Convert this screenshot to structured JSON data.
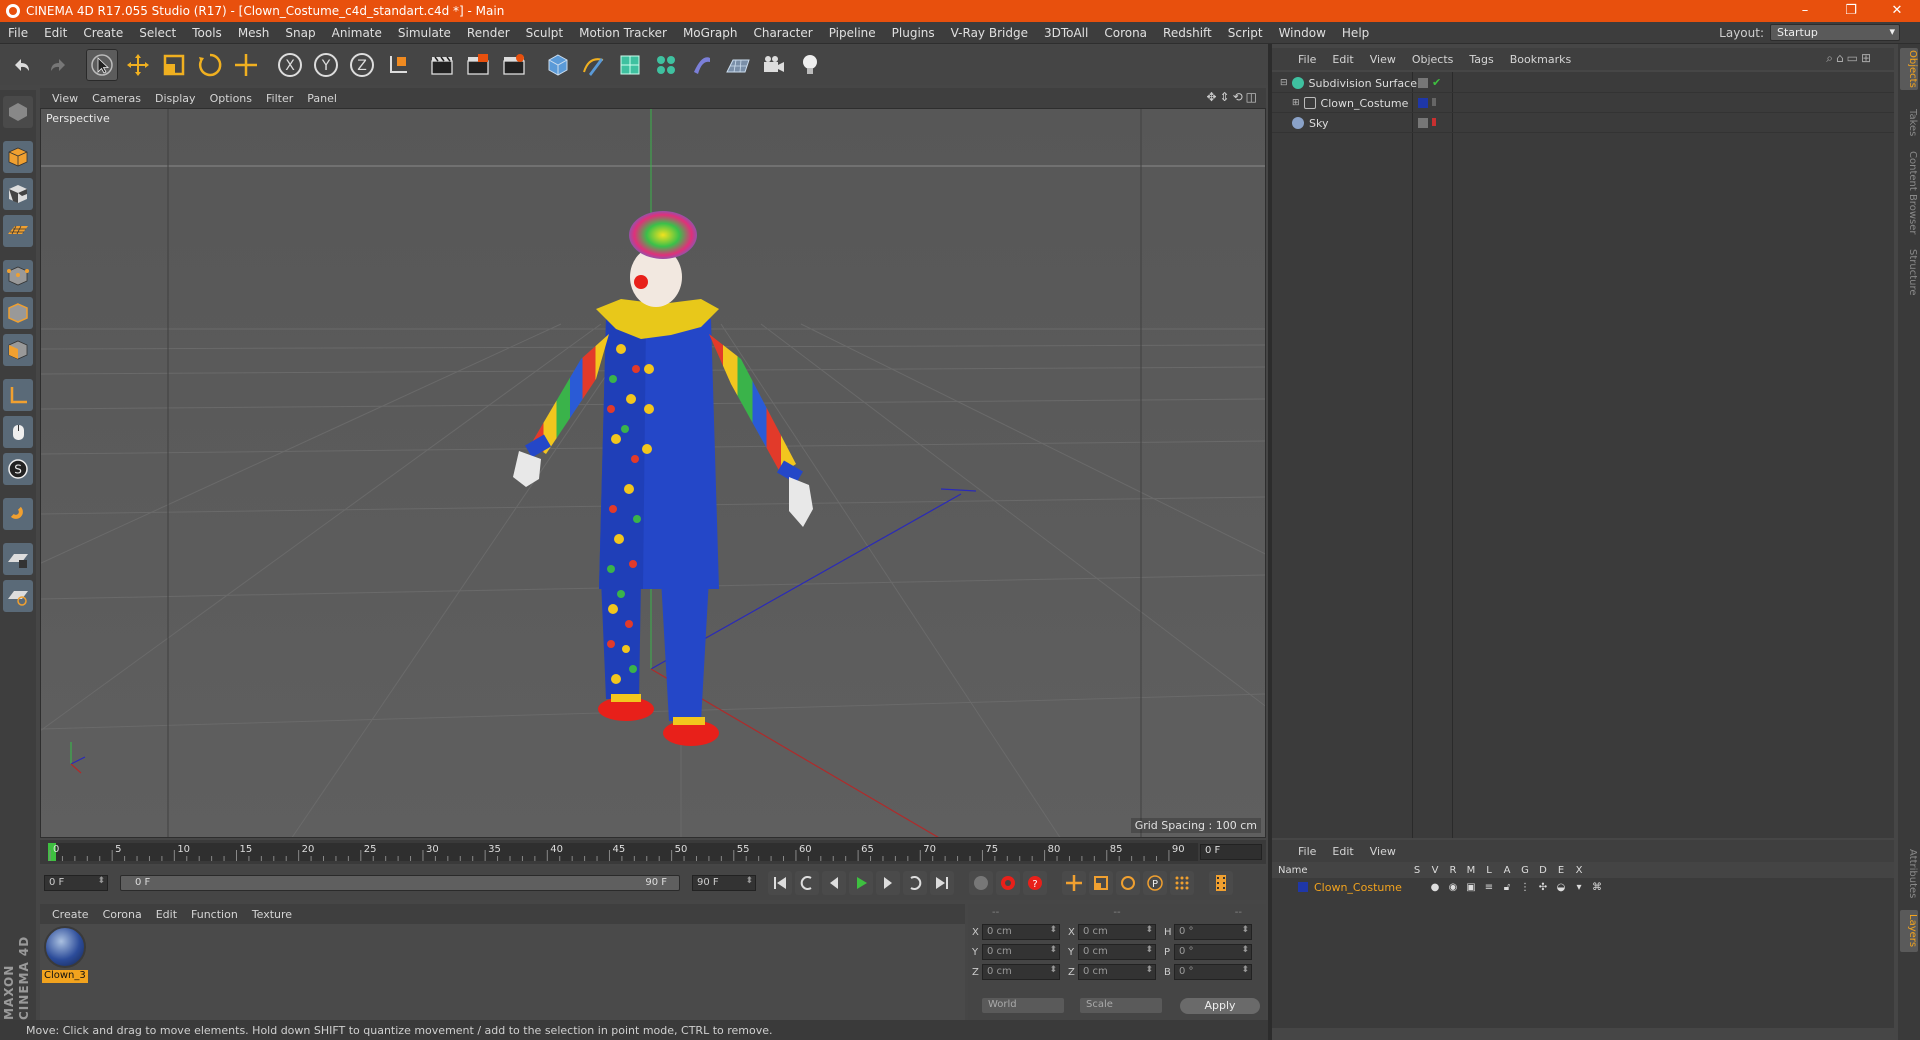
{
  "titlebar": {
    "title": "CINEMA 4D R17.055 Studio (R17) - [Clown_Costume_c4d_standart.c4d *] - Main",
    "minimize": "–",
    "restore": "❐",
    "close": "✕"
  },
  "menubar": {
    "items": [
      "File",
      "Edit",
      "Create",
      "Select",
      "Tools",
      "Mesh",
      "Snap",
      "Animate",
      "Simulate",
      "Render",
      "Sculpt",
      "Motion Tracker",
      "MoGraph",
      "Character",
      "Pipeline",
      "Plugins",
      "V-Ray Bridge",
      "3DToAll",
      "Corona",
      "Redshift",
      "Script",
      "Window",
      "Help"
    ],
    "layout_label": "Layout:",
    "layout_value": "Startup"
  },
  "viewport": {
    "menu": [
      "View",
      "Cameras",
      "Display",
      "Options",
      "Filter",
      "Panel"
    ],
    "label": "Perspective",
    "grid_spacing": "Grid Spacing : 100 cm"
  },
  "timeline": {
    "ticks": [
      "0",
      "5",
      "10",
      "15",
      "20",
      "25",
      "30",
      "35",
      "40",
      "45",
      "50",
      "55",
      "60",
      "65",
      "70",
      "75",
      "80",
      "85",
      "90"
    ],
    "current_frame": "0 F"
  },
  "transport": {
    "start_field": "0 F",
    "slider_left": "0 F",
    "slider_right": "90 F",
    "end_field": "90 F"
  },
  "materials": {
    "menu": [
      "Create",
      "Corona",
      "Edit",
      "Function",
      "Texture"
    ],
    "items": [
      {
        "name": "Clown_3"
      }
    ]
  },
  "coordinates": {
    "headers": [
      "--",
      "--",
      "--"
    ],
    "rows": [
      {
        "a": "X",
        "av": "0 cm",
        "b": "X",
        "bv": "0 cm",
        "c": "H",
        "cv": "0 °"
      },
      {
        "a": "Y",
        "av": "0 cm",
        "b": "Y",
        "bv": "0 cm",
        "c": "P",
        "cv": "0 °"
      },
      {
        "a": "Z",
        "av": "0 cm",
        "b": "Z",
        "bv": "0 cm",
        "c": "B",
        "cv": "0 °"
      }
    ],
    "space": "World",
    "mode": "Scale",
    "apply": "Apply"
  },
  "status": {
    "text": "Move: Click and drag to move elements. Hold down SHIFT to quantize movement / add to the selection in point mode, CTRL to remove."
  },
  "object_manager": {
    "menu": [
      "File",
      "Edit",
      "View",
      "Objects",
      "Tags",
      "Bookmarks"
    ],
    "objects": [
      {
        "name": "Subdivision Surface",
        "icon_color": "#3fc1a0"
      },
      {
        "name": "Clown_Costume",
        "icon_color": "#9a9a9a"
      },
      {
        "name": "Sky",
        "icon_color": "#8aa2c8"
      }
    ]
  },
  "layers_manager": {
    "menu": [
      "File",
      "Edit",
      "View"
    ],
    "name_header": "Name",
    "columns": [
      "S",
      "V",
      "R",
      "M",
      "L",
      "A",
      "G",
      "D",
      "E",
      "X"
    ],
    "layers": [
      {
        "name": "Clown_Costume",
        "color": "#1f37a8"
      }
    ]
  },
  "right_tabs": [
    "Objects",
    "Takes",
    "Content Browser",
    "Structure",
    "Attributes",
    "Layers"
  ],
  "brand": {
    "logo_text": "MAXON CINEMA 4D"
  }
}
